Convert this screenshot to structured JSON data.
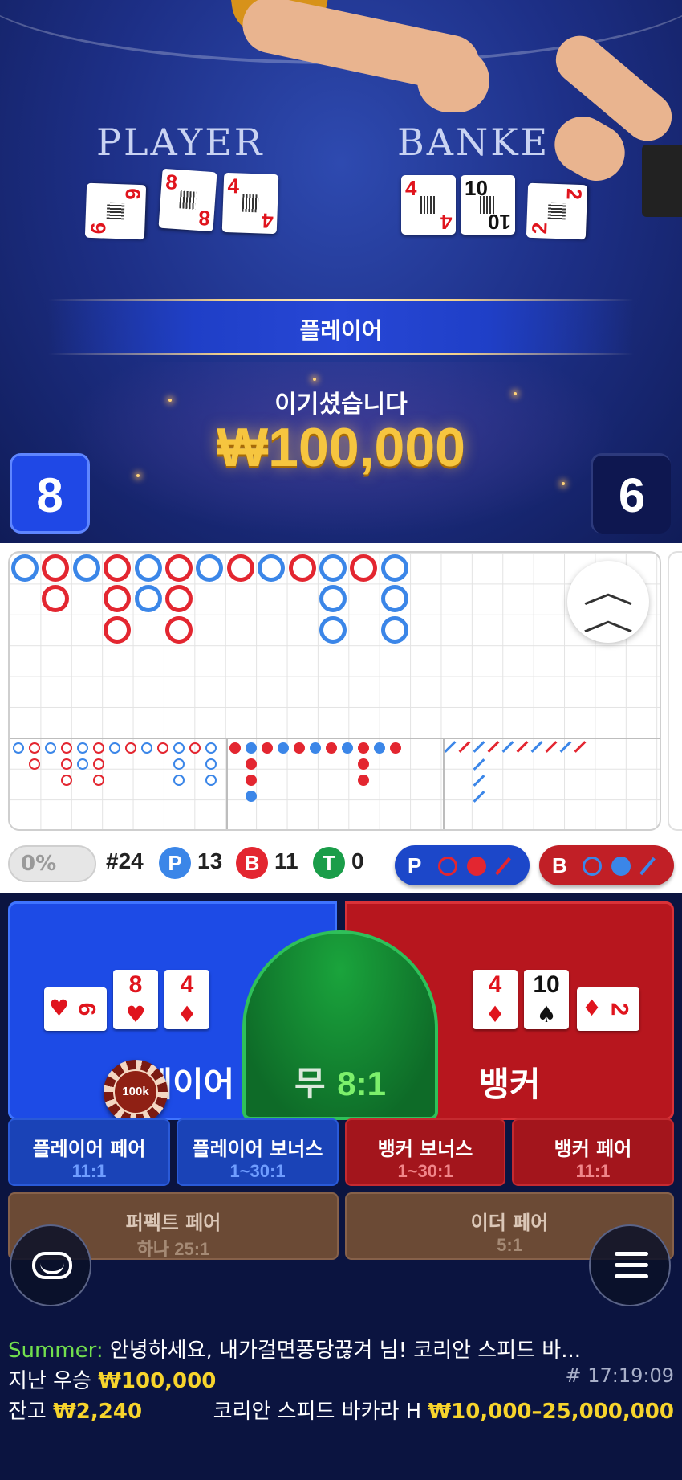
{
  "video": {
    "player_label": "PLAYER",
    "banker_label": "BANKE",
    "player_cards": [
      {
        "rank": "6",
        "suit": "♥",
        "color": "red"
      },
      {
        "rank": "8",
        "suit": "♥",
        "color": "red"
      },
      {
        "rank": "4",
        "suit": "♦",
        "color": "red"
      }
    ],
    "banker_cards": [
      {
        "rank": "4",
        "suit": "♦",
        "color": "red"
      },
      {
        "rank": "10",
        "suit": "♠",
        "color": "black"
      },
      {
        "rank": "2",
        "suit": "♦",
        "color": "red"
      }
    ],
    "result": "플레이어",
    "win_label": "이기셨습니다",
    "win_amount": "₩100,000",
    "player_score": "8",
    "banker_score": "6"
  },
  "roadmap": {
    "bead_road_columns": [
      [
        "P"
      ],
      [
        "B",
        "B"
      ],
      [
        "P"
      ],
      [
        "B",
        "B",
        "B"
      ],
      [
        "P",
        "P"
      ],
      [
        "B",
        "B",
        "B"
      ],
      [
        "P"
      ],
      [
        "B"
      ],
      [
        "P"
      ],
      [
        "B"
      ],
      [
        "P",
        "P",
        "P"
      ],
      [
        "B"
      ],
      [
        "P",
        "P",
        "P"
      ]
    ],
    "percent": "0%",
    "round": "#24",
    "player_badge": "P",
    "player_count": "13",
    "banker_badge": "B",
    "banker_count": "11",
    "tie_badge": "T",
    "tie_count": "0",
    "player_predict_label": "P",
    "banker_predict_label": "B",
    "colors": {
      "player": "#3b86e8",
      "banker": "#e32630",
      "tie": "#1a9d49"
    }
  },
  "bet": {
    "player": {
      "label": "플레이어",
      "cards": [
        {
          "rank": "6",
          "suit": "♥"
        },
        {
          "rank": "8",
          "suit": "♥"
        },
        {
          "rank": "4",
          "suit": "♦"
        }
      ]
    },
    "tie": {
      "label": "무",
      "odds": "8:1"
    },
    "banker": {
      "label": "뱅커",
      "cards": [
        {
          "rank": "4",
          "suit": "♦"
        },
        {
          "rank": "10",
          "suit": "♠"
        },
        {
          "rank": "2",
          "suit": "♦"
        }
      ]
    },
    "chip": "100k",
    "side_bets": [
      {
        "name": "플레이어 페어",
        "odds": "11:1"
      },
      {
        "name": "플레이어 보너스",
        "odds": "1~30:1"
      },
      {
        "name": "뱅커 보너스",
        "odds": "1~30:1"
      },
      {
        "name": "뱅커 페어",
        "odds": "11:1"
      },
      {
        "name": "퍼펙트 페어",
        "odds": "하나 25:1"
      },
      {
        "name": "이더 페어",
        "odds": "5:1"
      }
    ]
  },
  "info": {
    "chat_user": "Summer:",
    "chat_message": "안녕하세요, 내가걸면퐁당끊겨 님! 코리안 스피드 바...",
    "last_win_label": "지난 우승",
    "last_win_amount": "₩100,000",
    "round_time": "# 17:19:09",
    "balance_label": "잔고",
    "balance_amount": "₩2,240",
    "table_name": "코리안 스피드 바카라 H",
    "limits": "₩10,000–25,000,000"
  }
}
